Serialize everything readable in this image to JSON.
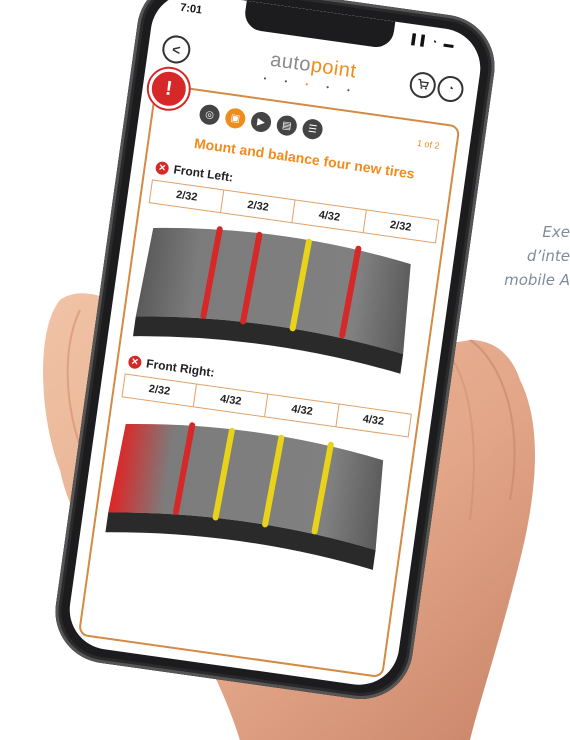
{
  "caption": {
    "line1": "Exe",
    "line2": "d’inte",
    "line3": "mobile A"
  },
  "status_bar": {
    "time": "7:01",
    "icons": "▐▐ ◔ ▬"
  },
  "header": {
    "logo_left": "auto",
    "logo_right": "point",
    "back_icon": "<",
    "cart_icon": "🛒",
    "clock_icon": "◔",
    "page_dots": [
      "•",
      "•",
      "•",
      "•",
      "•"
    ],
    "active_dot_index": 2
  },
  "alert": {
    "icon": "!"
  },
  "steps": {
    "icons": [
      "◎",
      "▣",
      "▶",
      "▤",
      "☰"
    ],
    "active_index": 1,
    "page_count": "1 of 2"
  },
  "main": {
    "title": "Mount and balance four new tires",
    "front_left": {
      "label": "Front Left:",
      "depths": [
        "2/32",
        "2/32",
        "4/32",
        "2/32"
      ],
      "groove_colors": [
        "#d62828",
        "#d62828",
        "#e8d21a",
        "#d62828"
      ]
    },
    "front_right": {
      "label": "Front Right:",
      "depths": [
        "2/32",
        "4/32",
        "4/32",
        "4/32"
      ],
      "groove_colors": [
        "#d62828",
        "#e8d21a",
        "#e8d21a",
        "#e8d21a"
      ]
    }
  },
  "colors": {
    "accent": "#f08c1e",
    "danger": "#d62828",
    "warning": "#e8d21a",
    "tire": "#7a7a7a"
  }
}
